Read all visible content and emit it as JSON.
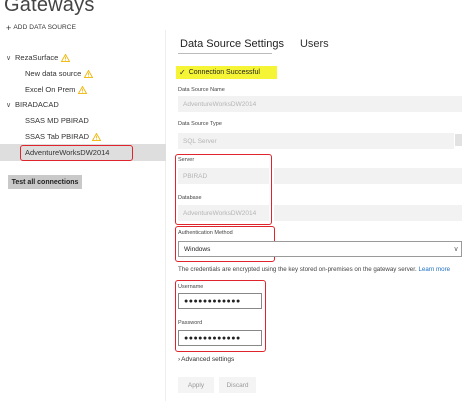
{
  "page": {
    "title": "Gateways"
  },
  "sidebar": {
    "add_data_source_label": "ADD DATA SOURCE",
    "tree": [
      {
        "label": "RezaSurface",
        "kind": "gateway",
        "warning": true
      },
      {
        "label": "New data source",
        "kind": "datasource",
        "warning": true
      },
      {
        "label": "Excel On Prem",
        "kind": "datasource",
        "warning": true
      },
      {
        "label": "BIRADACAD",
        "kind": "gateway",
        "warning": false
      },
      {
        "label": "SSAS MD PBIRAD",
        "kind": "datasource",
        "warning": false
      },
      {
        "label": "SSAS Tab PBIRAD",
        "kind": "datasource",
        "warning": true
      },
      {
        "label": "AdventureWorksDW2014",
        "kind": "datasource",
        "warning": false,
        "selected": true
      }
    ],
    "test_all_label": "Test all connections"
  },
  "tabs": [
    {
      "label": "Data Source Settings",
      "active": true
    },
    {
      "label": "Users",
      "active": false
    }
  ],
  "status": {
    "text": "Connection Successful"
  },
  "form": {
    "data_source_name": {
      "label": "Data Source Name",
      "value": "AdventureWorksDW2014"
    },
    "data_source_type": {
      "label": "Data Source Type",
      "value": "SQL Server"
    },
    "server": {
      "label": "Server",
      "value": "PBIRAD"
    },
    "database": {
      "label": "Database",
      "value": "AdventureWorksDW2014"
    },
    "auth_method": {
      "label": "Authentication Method",
      "value": "Windows"
    },
    "credentials_note": "The credentials are encrypted using the key stored on-premises on the gateway server.",
    "learn_more": "Learn more",
    "username": {
      "label": "Username",
      "value": "●●●●●●●●●●●●"
    },
    "password": {
      "label": "Password",
      "value": "●●●●●●●●●●●●"
    },
    "advanced_label": "Advanced settings",
    "apply_label": "Apply",
    "discard_label": "Discard"
  },
  "colors": {
    "highlight": "#f5f535",
    "annotation_red": "#e0242c",
    "link": "#1e6fc4",
    "warning": "#f0b400"
  }
}
